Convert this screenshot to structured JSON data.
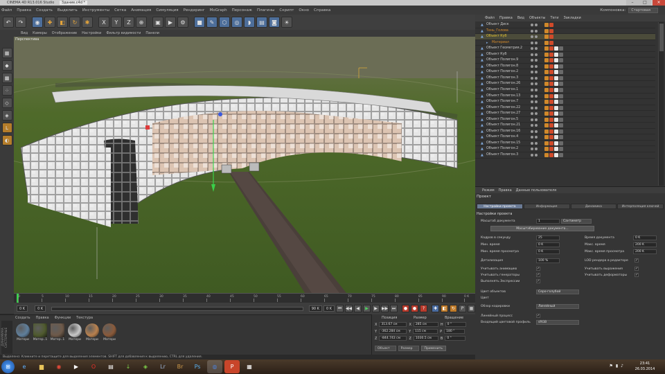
{
  "window": {
    "title": "CINEMA 4D R13.016 Studio",
    "doc": "Здание.c4d *"
  },
  "menu": [
    "Файл",
    "Правка",
    "Создать",
    "Выделить",
    "Инструменты",
    "Сетка",
    "Анимация",
    "Симуляция",
    "Рендеринг",
    "MoGraph",
    "Персонаж",
    "Плагины",
    "Скрипт",
    "Окно",
    "Справка"
  ],
  "layout": {
    "label": "Компоновка:",
    "value": "Стартовая"
  },
  "viewport_menu": [
    "Вид",
    "Камеры",
    "Отображение",
    "Настройки",
    "Фильтр видимости",
    "Панели"
  ],
  "viewport_label": "Перспектива",
  "timeline": {
    "ticks": [
      "0",
      "5",
      "10",
      "15",
      "20",
      "25",
      "30",
      "35",
      "40",
      "45",
      "50",
      "55",
      "60",
      "65",
      "70",
      "75",
      "80",
      "85",
      "90"
    ],
    "end": "0 K"
  },
  "playbar": {
    "start": "0 K",
    "current": "0 K",
    "end": "90 K",
    "fps": "0 K"
  },
  "materials": {
    "menu": [
      "Создать",
      "Правка",
      "Функции",
      "Текстура"
    ],
    "side_label": "ДИНАМИКА СИСТЕМНЫЕ",
    "items": [
      {
        "name": "Матери",
        "color": "#5f7f9c"
      },
      {
        "name": "Матер..1",
        "color": "#4f5a2e"
      },
      {
        "name": "Матер..1",
        "color": "#6e5a4a"
      },
      {
        "name": "Матери",
        "color": "#c8c8c8"
      },
      {
        "name": "Матери",
        "color": "#b9814e"
      },
      {
        "name": "Матери",
        "color": "#8a5a3a"
      }
    ]
  },
  "coords": {
    "headers": [
      "Позиция",
      "Размер",
      "Вращение"
    ],
    "rows": [
      [
        "X",
        "313.67 см",
        "X",
        "285 см",
        "H",
        "0 °"
      ],
      [
        "Y",
        "-362.284 см",
        "Y",
        "115 см",
        "P",
        "180 °"
      ],
      [
        "Z",
        "-844.743 см",
        "Z",
        "1030.5 см",
        "B",
        "0 °"
      ]
    ],
    "mode1": "Объект",
    "mode2": "Размер",
    "apply": "Применить"
  },
  "status": "Выделено: Кликните и перетащите для выделения элементов. SHIFT для добавления к выделению, CTRL для удаления.",
  "object_manager": {
    "menu": [
      "Файл",
      "Правка",
      "Вид",
      "Объекты",
      "Теги",
      "Закладки"
    ],
    "rows": [
      {
        "name": "Объект Диск",
        "indent": 0,
        "sel": false,
        "color": "#c8c8c8"
      },
      {
        "name": "Тень_Голова",
        "indent": 0,
        "sel": false,
        "color": "#d48a2a"
      },
      {
        "name": "Объект Куб",
        "indent": 0,
        "sel": true,
        "color": "#e0c030"
      },
      {
        "name": "Материал",
        "indent": 1,
        "sel": false,
        "color": "#d48a2a"
      },
      {
        "name": "Объект Геометрия.2",
        "indent": 0,
        "sel": false,
        "color": "#c8c8c8"
      },
      {
        "name": "Объект Куб",
        "indent": 0,
        "sel": false,
        "color": "#c8c8c8"
      },
      {
        "name": "Объект Полигон.9",
        "indent": 0,
        "sel": false,
        "color": "#c8c8c8"
      },
      {
        "name": "Объект Полигон.8",
        "indent": 0,
        "sel": false,
        "color": "#c8c8c8"
      },
      {
        "name": "Объект Полигон.2",
        "indent": 0,
        "sel": false,
        "color": "#c8c8c8"
      },
      {
        "name": "Объект Полигон.3",
        "indent": 0,
        "sel": false,
        "color": "#c8c8c8"
      },
      {
        "name": "Объект Полигон.26",
        "indent": 0,
        "sel": false,
        "color": "#c8c8c8"
      },
      {
        "name": "Объект Полигон.1",
        "indent": 0,
        "sel": false,
        "color": "#c8c8c8"
      },
      {
        "name": "Объект Полигон.13",
        "indent": 0,
        "sel": false,
        "color": "#c8c8c8"
      },
      {
        "name": "Объект Полигон.7",
        "indent": 0,
        "sel": false,
        "color": "#c8c8c8"
      },
      {
        "name": "Объект Полигон.22",
        "indent": 0,
        "sel": false,
        "color": "#c8c8c8"
      },
      {
        "name": "Объект Полигон.27",
        "indent": 0,
        "sel": false,
        "color": "#c8c8c8"
      },
      {
        "name": "Объект Полигон.5",
        "indent": 0,
        "sel": false,
        "color": "#c8c8c8"
      },
      {
        "name": "Объект Полигон.21",
        "indent": 0,
        "sel": false,
        "color": "#c8c8c8"
      },
      {
        "name": "Объект Полигон.16",
        "indent": 0,
        "sel": false,
        "color": "#c8c8c8"
      },
      {
        "name": "Объект Полигон.4",
        "indent": 0,
        "sel": false,
        "color": "#c8c8c8"
      },
      {
        "name": "Объект Полигон.15",
        "indent": 0,
        "sel": false,
        "color": "#c8c8c8"
      },
      {
        "name": "Объект Полигон.2",
        "indent": 0,
        "sel": false,
        "color": "#c8c8c8"
      },
      {
        "name": "Объект Полигон.3",
        "indent": 0,
        "sel": false,
        "color": "#c8c8c8"
      }
    ]
  },
  "attr": {
    "menu": [
      "Режим",
      "Правка",
      "Данные пользователя"
    ],
    "title": "Проект",
    "tabs": [
      "Настройки проекта",
      "Информация",
      "Динамика",
      "Интерполяция ключей"
    ],
    "section": "Настройки проекта",
    "scale_label": "Масштаб документа",
    "scale_value": "1",
    "scale_unit": "Сантиметр",
    "scale_btn": "Масштабирование документа...",
    "left_fields": [
      [
        "Кадров в секунду",
        "25"
      ],
      [
        "Мин. время",
        "0 K"
      ],
      [
        "Мин. время просмотра",
        "0 K"
      ]
    ],
    "right_fields": [
      [
        "Время документа",
        "0 K"
      ],
      [
        "Макс. время",
        "200 K"
      ],
      [
        "Макс. время просмотра",
        "200 K"
      ]
    ],
    "detail_label": "Детализация",
    "detail_value": "100 %",
    "lod_label": "LOD рендера в редакторе",
    "checks_left": [
      "Учитывать анимацию",
      "Учитывать генераторы",
      "Выполнять Экспрессии"
    ],
    "checks_right": [
      "Учитывать выражения",
      "Учитывать деформаторы"
    ],
    "objcolor_label": "Цвет объектов",
    "objcolor_value": "Серо-голубой",
    "color_label": "Цвет",
    "viewcorr_label": "Обзор кодировки",
    "viewcorr_value": "Линейный",
    "linear_label": "Линейный процесс",
    "colorprofile_label": "Входящий цветовой профиль",
    "colorprofile_value": "sRGB"
  },
  "taskbar": {
    "time": "23:41",
    "date": "26.03.2014"
  }
}
